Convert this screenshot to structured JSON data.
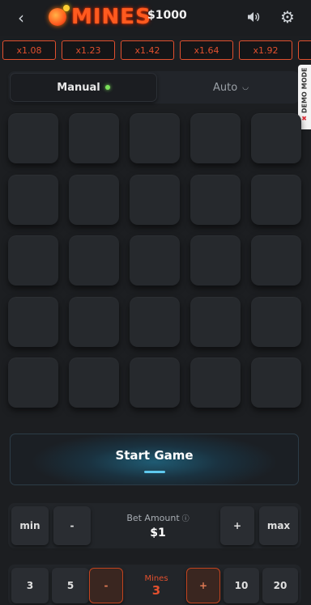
{
  "header": {
    "logo_text": "MINES",
    "balance": "$1000",
    "icons": {
      "back": "chevron-left-icon",
      "sound": "speaker-icon",
      "settings": "gear-icon",
      "logo": "bomb-icon"
    }
  },
  "multipliers": [
    "x1.08",
    "x1.23",
    "x1.42",
    "x1.64",
    "x1.92"
  ],
  "tabs": {
    "manual": "Manual",
    "auto": "Auto"
  },
  "demo_badge": {
    "text": "DEMO MODE",
    "mark": "✖"
  },
  "grid": {
    "rows": 5,
    "cols": 5
  },
  "start_button": {
    "label": "Start Game"
  },
  "bet": {
    "min_label": "min",
    "minus_label": "-",
    "label": "Bet Amount",
    "value": "$1",
    "plus_label": "+",
    "max_label": "max"
  },
  "mines": {
    "preset_a": "3",
    "preset_b": "5",
    "minus_label": "-",
    "label": "Mines",
    "value": "3",
    "plus_label": "+",
    "preset_c": "10",
    "preset_d": "20"
  },
  "colors": {
    "accent_orange": "#e2502e",
    "accent_blue": "#5fc9ee",
    "background": "#1c1e21",
    "tile": "#26292d",
    "status_green": "#7be05a"
  }
}
